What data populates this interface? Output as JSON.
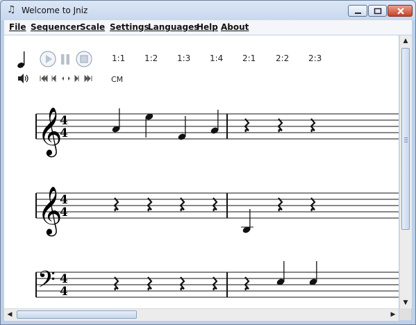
{
  "window": {
    "title": "Welcome to Jniz",
    "app_icon": "music-note-icon"
  },
  "menu": {
    "items": [
      "File",
      "Sequencer",
      "Scale",
      "Settings",
      "Languages",
      "Help",
      "About"
    ]
  },
  "toolbar": {
    "ratios": [
      "1:1",
      "1:2",
      "1:3",
      "1:4",
      "2:1",
      "2:2",
      "2:3"
    ],
    "key": "CM",
    "icons": [
      "quarter-note-icon",
      "play-icon",
      "pause-icon",
      "stop-icon",
      "volume-icon",
      "skip-first-icon",
      "skip-prev-icon",
      "step-back-icon",
      "step-forward-icon",
      "skip-next-icon",
      "skip-last-icon"
    ]
  },
  "score": {
    "time_signature": "4/4",
    "staves": [
      {
        "clef": "treble",
        "measures": [
          [
            "note",
            "note",
            "note",
            "note"
          ],
          [
            "rest",
            "rest",
            "rest"
          ]
        ]
      },
      {
        "clef": "treble",
        "measures": [
          [
            "rest",
            "rest",
            "rest",
            "rest"
          ],
          [
            "note",
            "rest",
            "rest"
          ]
        ]
      },
      {
        "clef": "bass",
        "measures": [
          [
            "rest",
            "rest",
            "rest",
            "rest"
          ],
          [
            "rest",
            "note",
            "note"
          ]
        ]
      }
    ]
  }
}
